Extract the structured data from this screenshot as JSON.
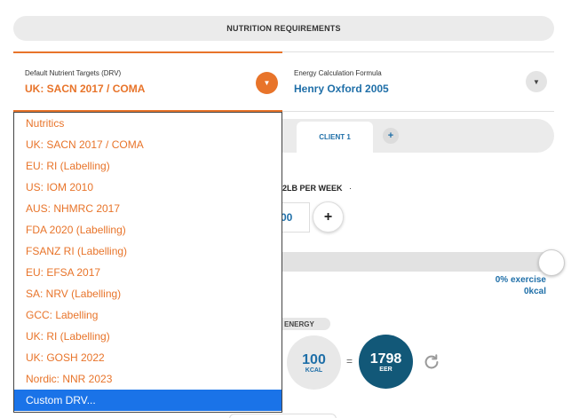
{
  "header": {
    "title": "NUTRITION REQUIREMENTS"
  },
  "drv": {
    "label": "Default Nutrient Targets (DRV)",
    "value": "UK: SACN 2017 / COMA",
    "toggle_glyph": "▼"
  },
  "energy_formula": {
    "label": "Energy Calculation Formula",
    "value": "Henry Oxford 2005",
    "toggle_glyph": "▼"
  },
  "client": {
    "tab_label": "CLIENT 1",
    "add_glyph": "+"
  },
  "weight": {
    "text": "2LB PER WEEK",
    "dot": "·",
    "stepper_value": "00",
    "plus_glyph": "+"
  },
  "exercise": {
    "percent": "0% exercise",
    "kcal": "0kcal",
    "slider_level": 1.0
  },
  "energy_summary": {
    "chip_label": "ENERGY",
    "kcal_value": "100",
    "kcal_unit": "KCAL",
    "equals": "=",
    "eer_value": "1798",
    "eer_unit": "EER"
  },
  "dropdown": {
    "options": [
      "Nutritics",
      "UK: SACN 2017 / COMA",
      "EU: RI (Labelling)",
      "US: IOM 2010",
      "AUS: NHMRC 2017",
      "FDA 2020 (Labelling)",
      "FSANZ RI (Labelling)",
      "EU: EFSA 2017",
      "SA: NRV (Labelling)",
      "GCC: Labelling",
      "UK: RI (Labelling)",
      "UK: GOSH 2022",
      "Nordic: NNR 2023",
      "Custom DRV..."
    ],
    "highlighted_index": 13
  },
  "colors": {
    "accent_orange": "#e8742a",
    "accent_blue": "#1f6fa8",
    "eer_dark": "#125878",
    "highlight": "#1a73e8"
  }
}
